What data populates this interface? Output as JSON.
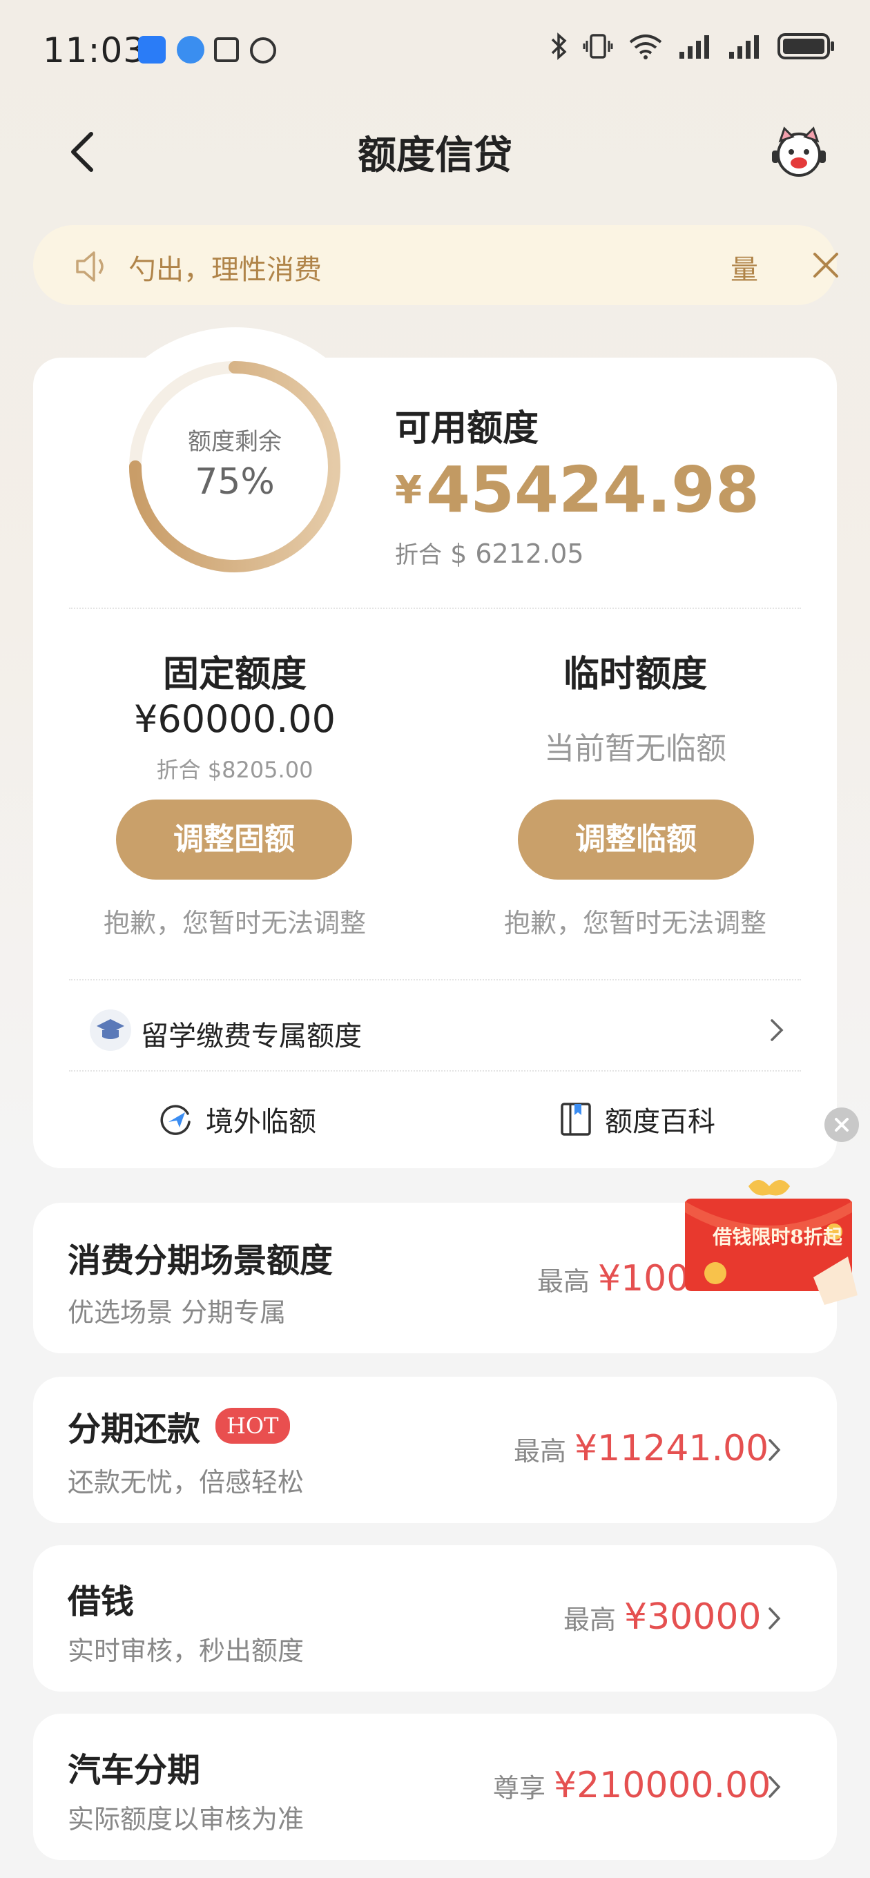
{
  "status_bar": {
    "time": "11:03"
  },
  "header": {
    "title": "额度信贷"
  },
  "notice": {
    "text": "勺出，理性消费",
    "tail": "量"
  },
  "credit": {
    "ring_label": "额度剩余",
    "ring_percent": "75%",
    "ring_fraction": 0.75,
    "available_label": "可用额度",
    "available_currency": "¥",
    "available_amount": "45424.98",
    "usd_prefix": "折合",
    "usd_amount": "$ 6212.05",
    "fixed": {
      "title": "固定额度",
      "amount": "¥60000.00",
      "usd": "折合 $8205.00",
      "button": "调整固额",
      "note": "抱歉，您暂时无法调整"
    },
    "temp": {
      "title": "临时额度",
      "none": "当前暂无临额",
      "button": "调整临额",
      "note": "抱歉，您暂时无法调整"
    },
    "study": {
      "label": "留学缴费专属额度"
    },
    "links": {
      "overseas": "境外临额",
      "wiki": "额度百科"
    }
  },
  "products": [
    {
      "title": "消费分期场景额度",
      "sub": "优选场景 分期专属",
      "prefix": "最高",
      "value": "¥100"
    },
    {
      "title": "分期还款",
      "badge": "HOT",
      "sub": "还款无忧，倍感轻松",
      "prefix": "最高",
      "value": "¥11241.00"
    },
    {
      "title": "借钱",
      "sub": "实时审核，秒出额度",
      "prefix": "最高",
      "value": "¥30000"
    },
    {
      "title": "汽车分期",
      "sub": "实际额度以审核为准",
      "prefix": "尊享",
      "value": "¥210000.00"
    }
  ],
  "promo": {
    "text": "借钱限时8折起"
  },
  "colors": {
    "gold": "#c9a06a",
    "red": "#e55050",
    "notice_bg": "#fbf4e3"
  }
}
